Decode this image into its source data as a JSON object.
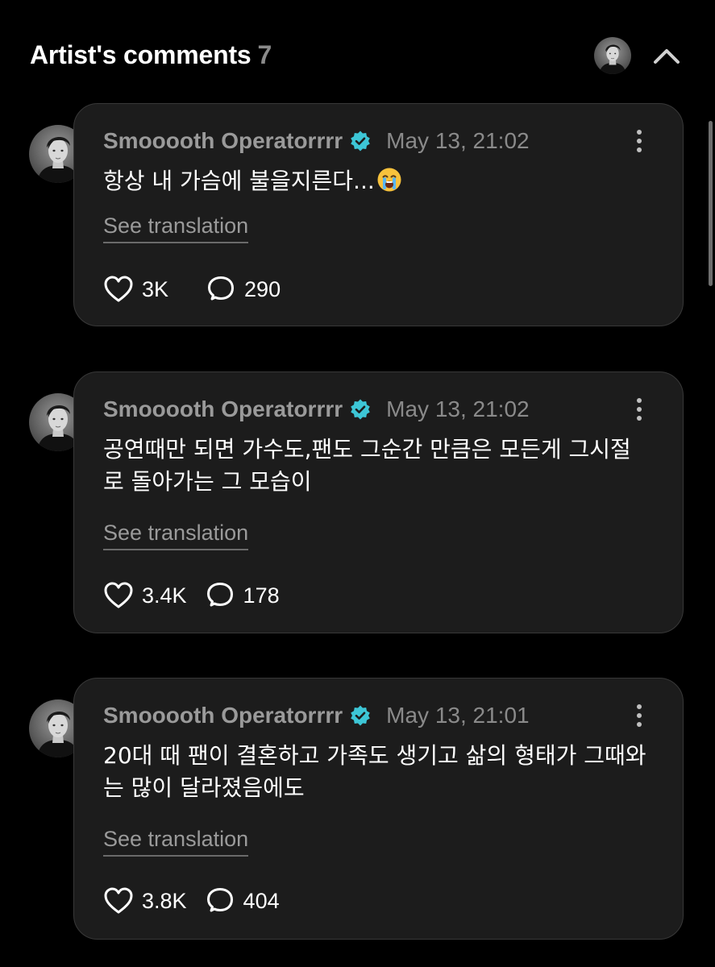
{
  "header": {
    "title": "Artist's comments",
    "count": "7",
    "avatar_icon": "artist-avatar",
    "collapse_icon": "chevron-up-icon"
  },
  "comments": [
    {
      "author": "Smooooth Operatorrrr",
      "timestamp": "May 13, 21:02",
      "text": "항상 내 가슴에 불을지른다...",
      "emoji": "loudly-crying-face",
      "translate_label": "See translation",
      "likes": "3K",
      "replies": "290"
    },
    {
      "author": "Smooooth Operatorrrr",
      "timestamp": "May 13, 21:02",
      "text": "공연때만 되면 가수도,팬도 그순간 만큼은 모든게 그시절로 돌아가는 그 모습이",
      "translate_label": "See translation",
      "likes": "3.4K",
      "replies": "178"
    },
    {
      "author": "Smooooth Operatorrrr",
      "timestamp": "May 13, 21:01",
      "text": "20대 때 팬이 결혼하고 가족도 생기고 삶의 형태가 그때와는 많이 달라졌음에도",
      "translate_label": "See translation",
      "likes": "3.8K",
      "replies": "404"
    }
  ],
  "colors": {
    "background": "#000000",
    "card": "#1c1c1c",
    "card_border": "#383838",
    "verified_badge": "#3dc6d6",
    "muted_text": "#9a9a9a"
  }
}
